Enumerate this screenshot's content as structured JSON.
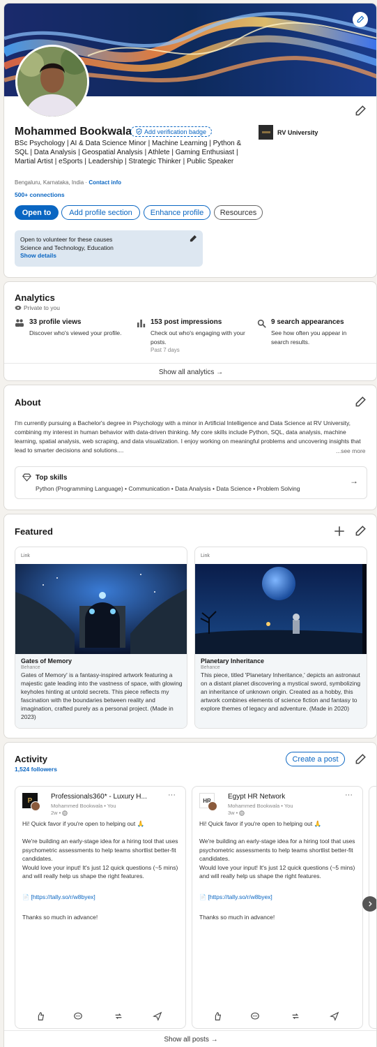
{
  "profile": {
    "name": "Mohammed Bookwala",
    "verify_badge": "Add verification badge",
    "headline": "BSc Psychology | AI & Data Science Minor | Machine Learning | Python & SQL | Data Analysis | Geospatial Analysis | Athlete | Gaming Enthusiast | Martial Artist | eSports | Leadership | Strategic Thinker | Public Speaker",
    "location": "Bengaluru, Karnataka, India",
    "location_sep": "·",
    "contact_info": "Contact info",
    "connections": "500+ connections",
    "education": "RV University",
    "buttons": {
      "open_to": "Open to",
      "add_section": "Add profile section",
      "enhance": "Enhance profile",
      "resources": "Resources"
    },
    "volunteer": {
      "title": "Open to volunteer for these causes",
      "causes": "Science and Technology, Education",
      "show_details": "Show details"
    }
  },
  "analytics": {
    "title": "Analytics",
    "privacy": "Private to you",
    "items": [
      {
        "title": "33 profile views",
        "desc": "Discover who's viewed your profile.",
        "note": ""
      },
      {
        "title": "153 post impressions",
        "desc": "Check out who's engaging with your posts.",
        "note": "Past 7 days"
      },
      {
        "title": "9 search appearances",
        "desc": "See how often you appear in search results.",
        "note": ""
      }
    ],
    "show_all": "Show all analytics →"
  },
  "about": {
    "title": "About",
    "text": "I'm currently pursuing a Bachelor's degree in Psychology with a minor in Artificial Intelligence and Data Science at RV University, combining my interest in human behavior with data-driven thinking. My core skills include Python, SQL, data analysis, machine learning, spatial analysis, web scraping, and data visualization. I enjoy working on meaningful problems and uncovering insights that lead to smarter decisions and solutions....",
    "see_more": "...see more",
    "top_skills_title": "Top skills",
    "top_skills": "Python (Programming Language) • Communication • Data Analysis • Data Science • Problem Solving",
    "arrow": "→"
  },
  "featured": {
    "title": "Featured",
    "items": [
      {
        "type": "Link",
        "title": "Gates of Memory",
        "source": "Behance",
        "desc": "Gates of Memory' is a fantasy-inspired artwork featuring a majestic gate leading into the vastness of space, with glowing keyholes hinting at untold secrets. This piece reflects my fascination with the boundaries between reality and imagination, crafted purely as a personal project. (Made in 2023)"
      },
      {
        "type": "Link",
        "title": "Planetary Inheritance",
        "source": "Behance",
        "desc": "This piece, titled 'Planetary Inheritance,' depicts an astronaut on a distant planet discovering a mystical sword, symbolizing an inheritance of unknown origin. Created as a hobby, this artwork combines elements of science fiction and fantasy to explore themes of legacy and adventure. (Made in 2020)"
      }
    ]
  },
  "activity": {
    "title": "Activity",
    "followers": "1,524 followers",
    "create_post": "Create a post",
    "posts": [
      {
        "group": "Professionals360* - Luxury H...",
        "author": "Mohammed Bookwala • You",
        "time": "2w •",
        "text": "Hi! Quick favor if you're open to helping out 🙏\n\nWe're building an early-stage idea for a hiring tool that uses psychometric assessments to help teams shortlist better-fit candidates.\nWould love your input! It's just 12 quick questions (~5 mins) and will really help us shape the right features.",
        "link_emoji": "📄",
        "link": "[https://tally.so/r/w8byex]",
        "thanks": "Thanks so much in advance!"
      },
      {
        "group": "Egypt HR Network",
        "author": "Mohammed Bookwala • You",
        "time": "3w •",
        "text": "Hi! Quick favor if you're open to helping out 🙏\n\nWe're building an early-stage idea for a hiring tool that uses psychometric assessments to help teams shortlist better-fit candidates.\nWould love your input! It's just 12 quick questions (~5 mins) and will really help us shape the right features.",
        "link_emoji": "📄",
        "link": "[https://tally.so/r/w8byex]",
        "thanks": "Thanks so much in advance!"
      }
    ],
    "more": "···",
    "show_all": "Show all posts →"
  }
}
